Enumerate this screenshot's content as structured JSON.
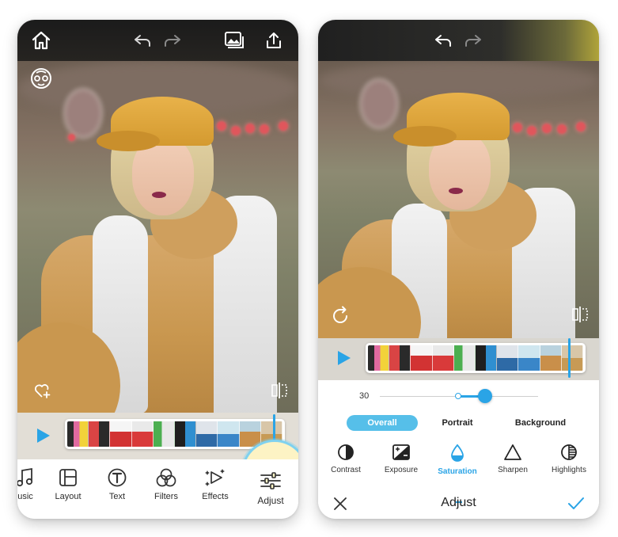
{
  "left_screen": {
    "toolbar": [
      {
        "name": "music",
        "label": "usic"
      },
      {
        "name": "layout",
        "label": "Layout"
      },
      {
        "name": "text",
        "label": "Text"
      },
      {
        "name": "filters",
        "label": "Filters"
      },
      {
        "name": "effects",
        "label": "Effects"
      },
      {
        "name": "adjust",
        "label": "Adjust"
      }
    ],
    "selected_tool": "adjust",
    "icons": [
      "home-icon",
      "undo-icon",
      "redo-icon",
      "gallery-icon",
      "share-icon",
      "face-retouch-icon",
      "heart-add-icon",
      "compare-icon",
      "play-icon"
    ]
  },
  "right_screen": {
    "slider": {
      "value": "30"
    },
    "segments": [
      {
        "name": "overall",
        "label": "Overall",
        "active": true
      },
      {
        "name": "portrait",
        "label": "Portrait",
        "active": false
      },
      {
        "name": "background",
        "label": "Background",
        "active": false
      }
    ],
    "adjust_options": [
      {
        "name": "contrast",
        "label": "Contrast"
      },
      {
        "name": "exposure",
        "label": "Exposure"
      },
      {
        "name": "saturation",
        "label": "Saturation"
      },
      {
        "name": "sharpen",
        "label": "Sharpen"
      },
      {
        "name": "highlights",
        "label": "Highlights"
      }
    ],
    "selected_option": "saturation",
    "title": "Adjust",
    "icons": [
      "undo-icon",
      "redo-icon",
      "rotate-icon",
      "compare-icon",
      "play-icon",
      "close-icon",
      "check-icon"
    ]
  },
  "colors": {
    "accent": "#2aa4e6",
    "segment_active": "#56bfe9",
    "halo_fill": "#fdf3c4",
    "halo_ring": "#7fd1ef"
  }
}
